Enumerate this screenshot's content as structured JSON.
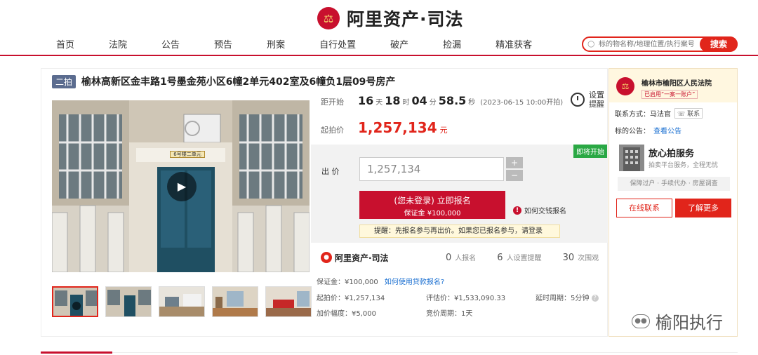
{
  "header": {
    "logo_emblem": "⚖",
    "logo_text": "阿里资产·司法",
    "nav": [
      "首页",
      "法院",
      "公告",
      "预告",
      "刑案",
      "自行处置",
      "破产",
      "捡漏",
      "精准获客"
    ],
    "search_placeholder": "标的物名称/地理位置/执行案号",
    "search_button": "搜索",
    "accent_color": "#e1251b"
  },
  "listing": {
    "badge": "二拍",
    "title": "榆林高新区金丰路1号墨金苑小区6幢2单元402室及6幢负1层09号房产",
    "image_sign": "6号楼二单元",
    "countdown": {
      "label": "距开始",
      "days": "16",
      "days_unit": "天",
      "hours": "18",
      "hours_unit": "时",
      "minutes": "04",
      "minutes_unit": "分",
      "seconds": "58.5",
      "seconds_unit": "秒",
      "start_time": "(2023-06-15 10:00开拍)"
    },
    "reminder": "设置提醒",
    "start_price_label": "起拍价",
    "start_price": "1,257,134",
    "start_price_unit": "元",
    "status_tag": "即将开始",
    "bid_label": "出 价",
    "bid_value": "1,257,134",
    "plus": "+",
    "minus": "−",
    "signup_line1": "(您未登录) 立即报名",
    "signup_line2": "保证金 ¥100,000",
    "how_pay": "如何交钱报名",
    "tip": "提醒：先报名参与再出价。如果您已报名参与，请登录",
    "brand": "阿里资产·司法",
    "signups_count": "0",
    "signups_label": "人报名",
    "reminders_count": "6",
    "reminders_label": "人设置提醒",
    "views_count": "30",
    "views_label": "次围观",
    "deposit": "保证金：¥100,000",
    "deposit_link": "如何使用贷款报名?",
    "start_price_detail": "起拍价：¥1,257,134",
    "appraisal": "评估价：¥1,533,090.33",
    "delay": "延时周期：5分钟",
    "increment": "加价幅度：¥5,000",
    "cycle": "竞价周期：1天"
  },
  "court": {
    "emblem": "⚖",
    "name": "榆林市榆阳区人民法院",
    "tag": "已启用“一案一账户”",
    "contact_label": "联系方式：马法官",
    "contact_button": "联系",
    "notice_label": "标的公告：",
    "notice_link": "查看公告",
    "assure_title": "放心拍服务",
    "assure_sub": "拍卖平台服务，全程无忧",
    "assure_pills": "保障过户 · 手续代办 · 房屋调查",
    "online_button": "在线联系",
    "more_button": "了解更多"
  },
  "watermark": {
    "icon": "●●",
    "text": "榆阳执行"
  }
}
